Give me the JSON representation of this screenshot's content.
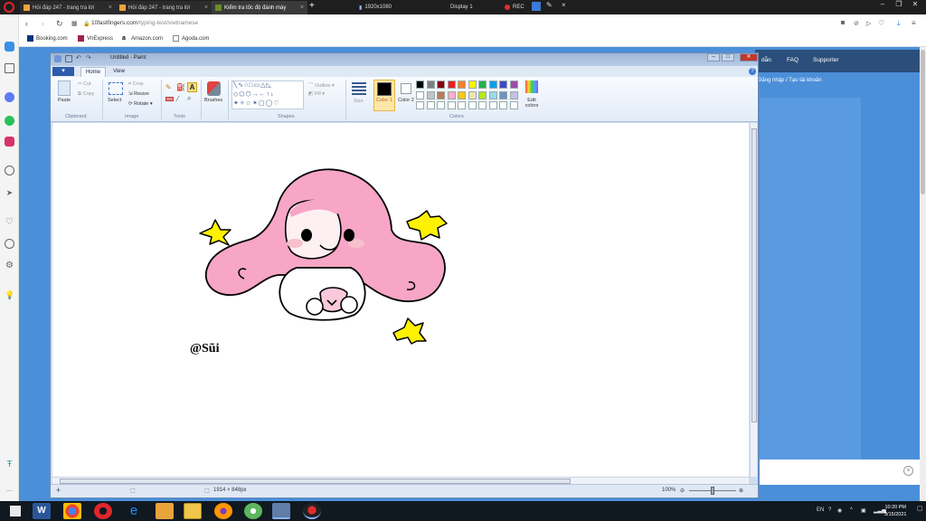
{
  "browser": {
    "tabs": [
      {
        "label": "Hỏi đáp 247 - trang tra lời"
      },
      {
        "label": "Hỏi đáp 247 - trang tra lời"
      },
      {
        "label": "Kiểm tra tốc độ đánh máy"
      }
    ],
    "recorder": {
      "resolution": "1920x1080",
      "display": "Display 1",
      "rec": "REC"
    },
    "url_domain": "10fastfingers.com",
    "url_path": "/typing-test/vietnamese",
    "bookmarks": [
      "Booking.com",
      "VnExpress",
      "Amazon.com",
      "Agoda.com"
    ]
  },
  "site": {
    "nav": [
      "dẫn",
      "FAQ",
      "Supporter"
    ],
    "login": "Đăng nhập / Tạo tài khoản"
  },
  "paint": {
    "title": "Untitled - Paint",
    "tabs": [
      "Home",
      "View"
    ],
    "clipboard": {
      "paste": "Paste",
      "cut": "Cut",
      "copy": "Copy",
      "group": "Clipboard"
    },
    "image": {
      "select": "Select",
      "crop": "Crop",
      "resize": "Resize",
      "rotate": "Rotate",
      "group": "Image"
    },
    "tools": {
      "group": "Tools"
    },
    "brushes": "Brushes",
    "shapes": {
      "outline": "Outline",
      "fill": "Fill",
      "group": "Shapes"
    },
    "size": "Size",
    "color1": "Color 1",
    "color2": "Color 2",
    "edit_colors": "Edit colors",
    "colors_group": "Colors",
    "palette": [
      "#000000",
      "#7f7f7f",
      "#880015",
      "#ed1c24",
      "#ff7f27",
      "#fff200",
      "#22b14c",
      "#00a2e8",
      "#3f48cc",
      "#a349a4",
      "#ffffff",
      "#c3c3c3",
      "#b97a57",
      "#ffaec9",
      "#ffc90e",
      "#efe4b0",
      "#b5e61d",
      "#99d9ea",
      "#7092be",
      "#c8bfe7"
    ],
    "canvas_signature": "@Sũi",
    "canvas_size": "1914 × 848px",
    "zoom": "100%"
  },
  "taskbar": {
    "time": "10:20 PM",
    "date": "3/15/2021",
    "lang": "EN"
  }
}
